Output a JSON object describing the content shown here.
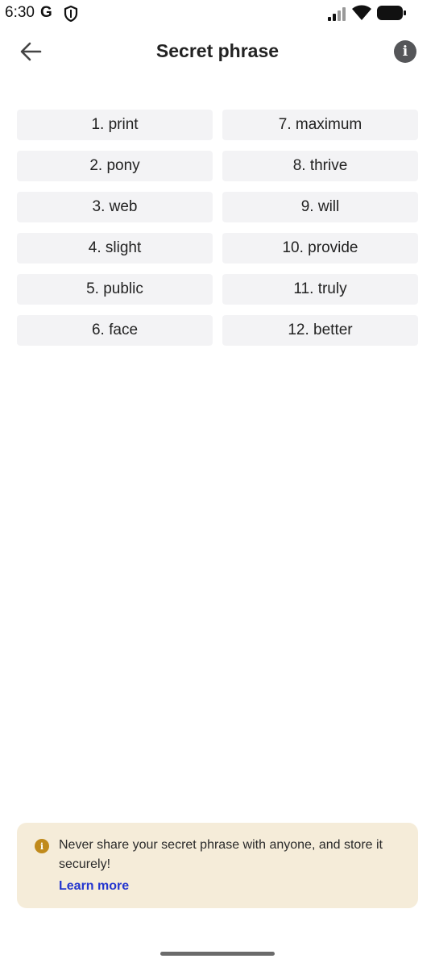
{
  "status_bar": {
    "time": "6:30",
    "google_glyph": "G",
    "icons": [
      "google-icon",
      "shield-icon",
      "signal-icon",
      "wifi-icon",
      "battery-icon"
    ]
  },
  "header": {
    "title": "Secret phrase",
    "back_icon": "arrow-left-icon",
    "info_icon": "info-icon",
    "info_glyph": "i"
  },
  "phrase": {
    "words": [
      {
        "label": "1. print"
      },
      {
        "label": "7. maximum"
      },
      {
        "label": "2. pony"
      },
      {
        "label": "8. thrive"
      },
      {
        "label": "3. web"
      },
      {
        "label": "9. will"
      },
      {
        "label": "4. slight"
      },
      {
        "label": "10. provide"
      },
      {
        "label": "5. public"
      },
      {
        "label": "11. truly"
      },
      {
        "label": "6. face"
      },
      {
        "label": "12. better"
      }
    ]
  },
  "warning": {
    "icon": "info-icon",
    "icon_glyph": "i",
    "text": "Never share your secret phrase with anyone, and store it securely!",
    "link_label": "Learn more"
  },
  "colors": {
    "chip_bg": "#f3f3f5",
    "warning_bg": "#f5ecd9",
    "warning_icon": "#c08a1c",
    "link": "#2436cf",
    "info_button": "#555659"
  }
}
